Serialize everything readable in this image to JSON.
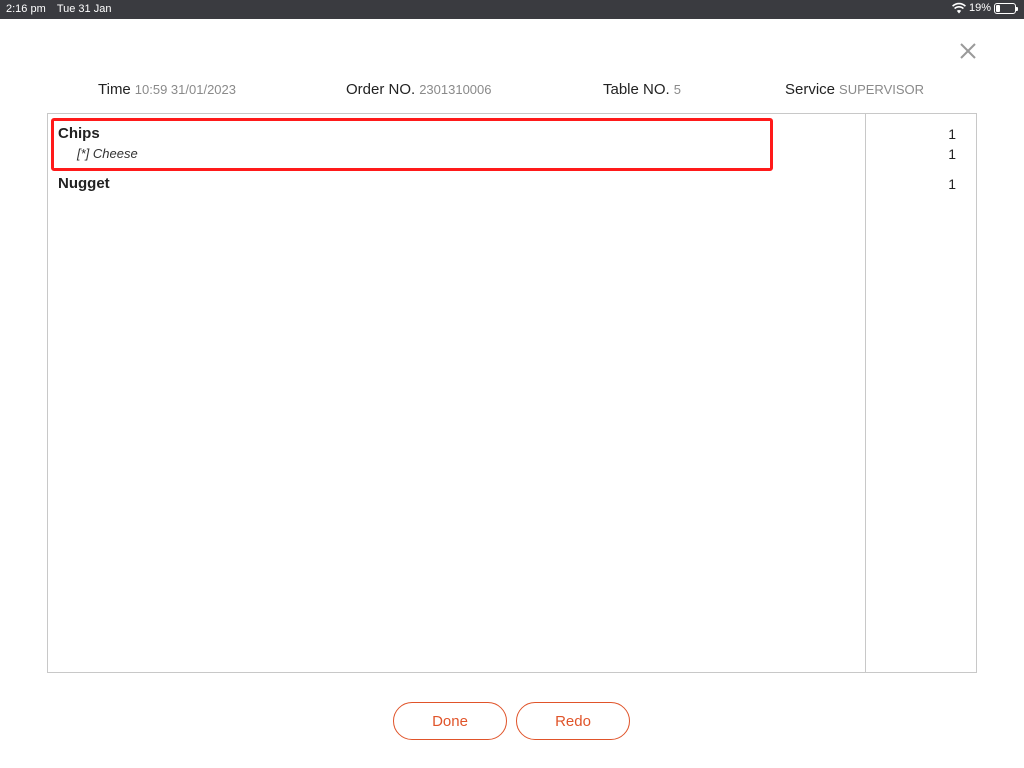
{
  "status_bar": {
    "time": "2:16 pm",
    "date": "Tue 31 Jan",
    "battery": "19%",
    "icons": [
      "wifi-icon",
      "battery-icon"
    ]
  },
  "header": {
    "time": {
      "label": "Time",
      "value": "10:59 31/01/2023"
    },
    "order": {
      "label": "Order NO.",
      "value": "2301310006"
    },
    "table": {
      "label": "Table NO.",
      "value": "5"
    },
    "service": {
      "label": "Service",
      "value": "SUPERVISOR"
    }
  },
  "order_items": [
    {
      "name": "Chips",
      "qty": "1",
      "modifiers": [
        {
          "text": "[*] Cheese",
          "qty": "1"
        }
      ]
    },
    {
      "name": "Nugget",
      "qty": "1",
      "modifiers": []
    }
  ],
  "buttons": {
    "done": "Done",
    "redo": "Redo"
  },
  "colors": {
    "accent": "#e0542a",
    "highlight": "#ff1a1a",
    "status_bar": "#3a3b40"
  },
  "icons": {
    "close": "close-icon"
  }
}
